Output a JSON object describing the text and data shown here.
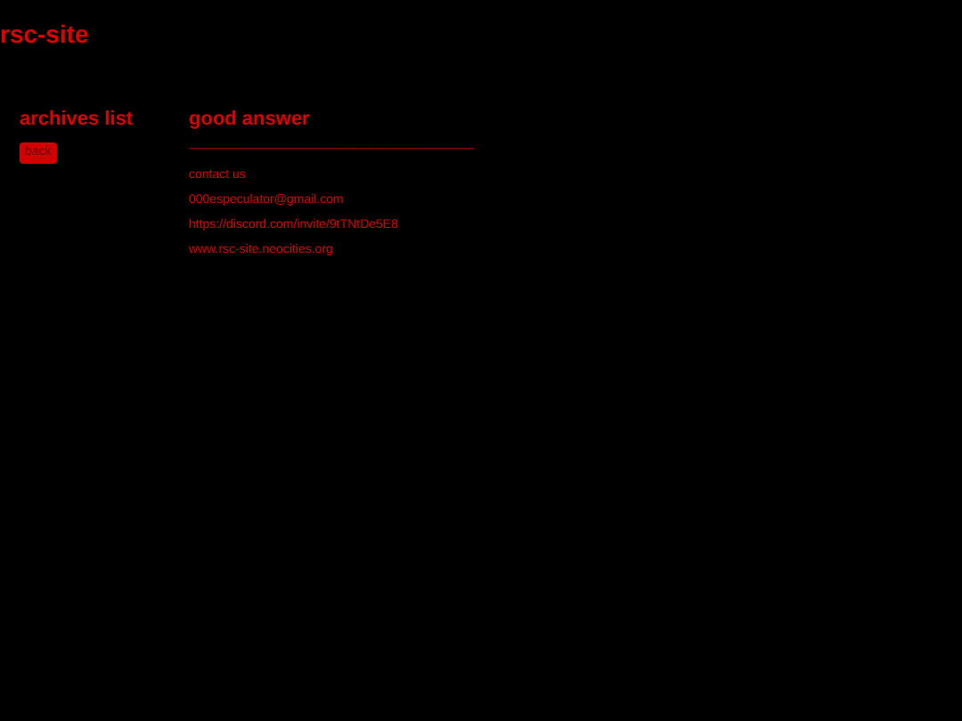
{
  "site_title": "rsc-site",
  "sidebar": {
    "heading": "archives list",
    "back_button": "back"
  },
  "main": {
    "heading": "good answer",
    "rule": "----------------------------------------------------------------------------------------------------",
    "lines": [
      "contact us",
      "000especulator@gmail.com",
      "https://discord.com/invite/9tTNtDe5E8",
      "www.rsc-site.neocities.org"
    ]
  }
}
